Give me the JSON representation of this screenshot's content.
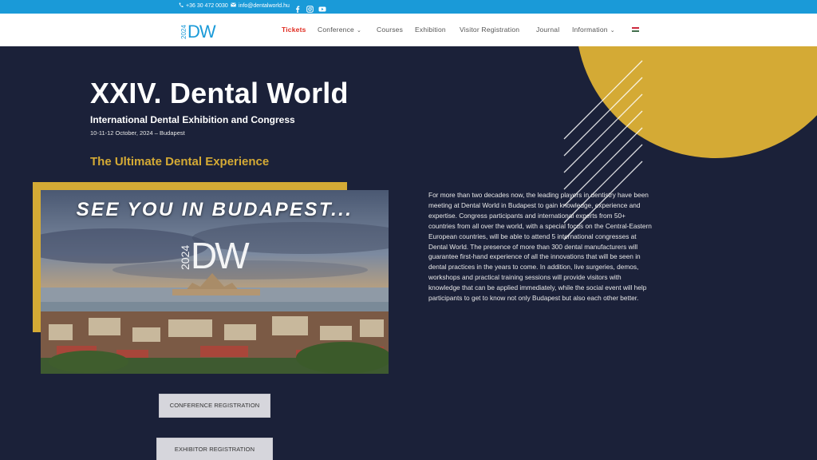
{
  "topbar": {
    "phone": "+36 30 472 0030",
    "email": "info@dentalworld.hu",
    "icons": [
      "phone-icon",
      "mail-icon",
      "facebook-icon",
      "instagram-icon",
      "youtube-icon"
    ]
  },
  "logo": {
    "year": "2024",
    "mark": "DW"
  },
  "nav": {
    "items": [
      {
        "label": "Tickets",
        "active": true
      },
      {
        "label": "Conference",
        "dropdown": true
      },
      {
        "label": "Courses"
      },
      {
        "label": "Exhibition"
      },
      {
        "label": "Visitor Registration"
      },
      {
        "label": "Journal"
      },
      {
        "label": "Information",
        "dropdown": true
      }
    ],
    "language_icon": "hungarian-flag-icon"
  },
  "hero": {
    "title": "XXIV. Dental World",
    "subtitle": "International Dental Exhibition and Congress",
    "date": "10-11-12 October, 2024 – Budapest",
    "tagline": "The Ultimate Dental Experience",
    "photo_caption": "SEE YOU IN BUDAPEST...",
    "photo_logo_year": "2024",
    "photo_logo_mark": "DW",
    "body": "For more than two decades now, the leading players in dentistry have been meeting at Dental World in Budapest to gain knowledge, experience and expertise. Congress participants and international experts from 50+ countries from all over the world, with a special focus on the Central-Eastern European countries, will be able to attend 5 international congresses at Dental World. The presence of more than 300 dental manufacturers will guarantee first-hand experience of all the innovations that will be seen in dental practices in the years to come. In addition, live surgeries, demos, workshops and practical training sessions will provide visitors with knowledge that can be applied immediately, while the social event will help participants to get to know not only Budapest but also each other better."
  },
  "buttons": {
    "conference": "CONFERENCE REGISTRATION",
    "exhibitor": "EXHIBITOR REGISTRATION"
  },
  "colors": {
    "topbar": "#1a9ad8",
    "hero_bg": "#1b2139",
    "gold": "#d4aa35",
    "active_nav": "#e02b20"
  }
}
